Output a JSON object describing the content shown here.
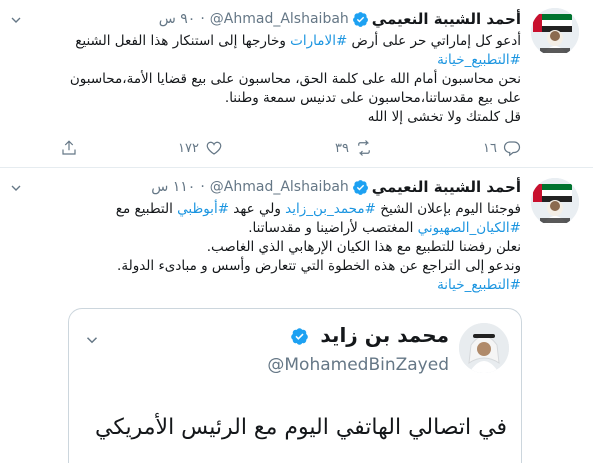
{
  "tweets": [
    {
      "name": "أحمد الشيبة النعيمي",
      "handle": "@Ahmad_Alshaibah",
      "time": "٩٠ س",
      "lines": [
        [
          "أدعو كل إماراتي حر على أرض ",
          "#الامارات",
          " وخارجها إلى استنكار هذا الفعل الشنيع"
        ],
        [
          "#التطبيع_خيانة"
        ],
        [
          "نحن محاسبون أمام الله على كلمة الحق، محاسبون على بيع قضايا الأمة،محاسبون"
        ],
        [
          "على بيع مقدساتنا،محاسبون على تدنيس سمعة وطننا."
        ],
        [
          "قل كلمتك ولا تخشى إلا الله"
        ]
      ],
      "actions": {
        "reply_count": "١٦",
        "retweet_count": "٣٩",
        "like_count": "١٧٢"
      }
    },
    {
      "name": "أحمد الشيبة النعيمي",
      "handle": "@Ahmad_Alshaibah",
      "time": "١١٠ س",
      "lines": [
        [
          "فوجئنا اليوم بإعلان الشيخ ",
          "#محمد_بن_زايد",
          " ولي عهد ",
          "#أبوظبي",
          " التطبيع مع"
        ],
        [
          "#الكيان_الصهيوني",
          " المغتصب لأراضينا و مقدساتنا."
        ],
        [
          "نعلن رفضنا للتطبيع مع هذا الكيان الإرهابي الذي الغاصب."
        ],
        [
          "وندعو إلى التراجع عن هذه الخطوة التي تتعارض وأسس و مبادىء الدولة."
        ],
        [
          "#التطبيع_خيانة"
        ]
      ]
    }
  ],
  "quote": {
    "name": "محمد بن زايد",
    "handle": "@MohamedBinZayed",
    "text": "في اتصالي الهاتفي اليوم مع الرئيس الأمريكي"
  },
  "colors": {
    "link": "#1b95e0",
    "verified": "#1da1f2",
    "muted": "#657786",
    "border": "#e6ecf0"
  },
  "icons": [
    "verified-badge-icon",
    "chevron-down-icon",
    "reply-icon",
    "retweet-icon",
    "like-icon",
    "share-icon"
  ]
}
